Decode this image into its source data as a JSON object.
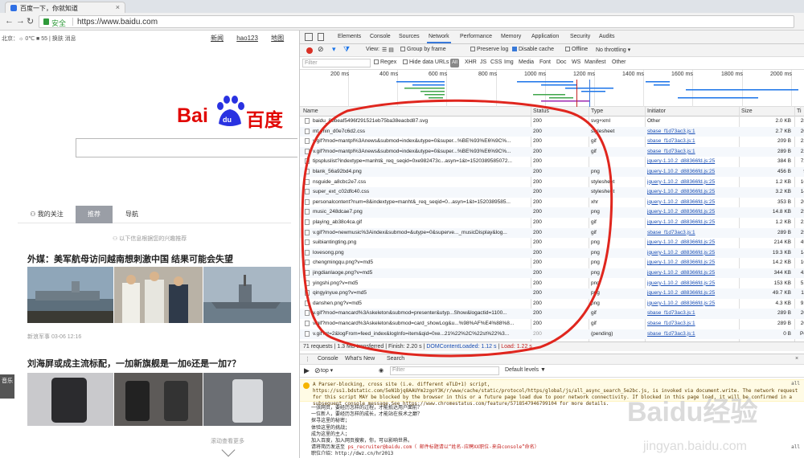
{
  "browser": {
    "tab_title": "百度一下，你就知道",
    "secure_label": "安全",
    "url": "https://www.baidu.com"
  },
  "baidu": {
    "weather": "北京：☼ 0℃  ■ 55 | 换肤  消息",
    "top_links": [
      "新闻",
      "hao123",
      "地图"
    ],
    "logo_left": "Bai",
    "logo_paw": "du",
    "logo_right": "百度",
    "feed_tabs": [
      "我的关注",
      "推荐",
      "导航"
    ],
    "hint": "以下信息根据您的兴趣推荐",
    "news1_title": "外媒：美军航母访问越南想刺激中国 结果可能会失望",
    "news1_meta": "新浪军事   03-06 12:16",
    "news2_title": "刘海屏或成主流标配，一加新旗舰是一加6还是一加7？",
    "side_badge": "音乐",
    "more": "滚动查看更多"
  },
  "devtools": {
    "tabs": [
      "Elements",
      "Console",
      "Sources",
      "Network",
      "Performance",
      "Memory",
      "Application",
      "Security",
      "Audits"
    ],
    "active_tab": "Network",
    "toolbar": {
      "view": "View:",
      "group": "Group by frame",
      "preserve": "Preserve log",
      "disable_cache": "Disable cache",
      "offline": "Offline",
      "throttling": "No throttling"
    },
    "filter_placeholder": "Filter",
    "filter_opts": [
      "Regex",
      "Hide data URLs",
      "All",
      "XHR",
      "JS",
      "CSS",
      "Img",
      "Media",
      "Font",
      "Doc",
      "WS",
      "Manifest",
      "Other"
    ],
    "timeline_ticks": [
      "200 ms",
      "400 ms",
      "600 ms",
      "800 ms",
      "1000 ms",
      "1200 ms",
      "1400 ms",
      "1600 ms",
      "1800 ms",
      "2000 ms"
    ],
    "columns": [
      "Name",
      "Status",
      "Type",
      "Initiator",
      "Size",
      "Ti"
    ],
    "rows": [
      {
        "name": "baidu_85beaf5496f291521eb75ba38eacbd87.svg",
        "status": "200",
        "type": "svg+xml",
        "initiator": "Other",
        "size": "2.0 KB",
        "time": "28"
      },
      {
        "name": "mt_min_d0e7c6d2.css",
        "status": "200",
        "type": "stylesheet",
        "initiator": "sbase_f1d73ac3.js:1",
        "size": "2.7 KB",
        "time": "20"
      },
      {
        "name": "v.gif?mod=mantpl%3Anews&submod=index&utype=0&super...%BE%93%E6%9C%...",
        "status": "200",
        "type": "gif",
        "initiator": "sbase_f1d73ac3.js:1",
        "size": "209 B",
        "time": "22"
      },
      {
        "name": "v.gif?mod=mantpl%3Anews&submod=index&utype=0&super...%BE%93%E6%9C%...",
        "status": "200",
        "type": "gif",
        "initiator": "sbase_f1d73ac3.js:1",
        "size": "289 B",
        "time": "22"
      },
      {
        "name": "tipspluslist?indextype=manht&_req_seqid=0xe982473c...asyn=1&t=1520389585072...",
        "status": "200",
        "type": "",
        "initiator": "jquery-1.10.2_d88366fd.js:25",
        "size": "384 B",
        "time": "72"
      },
      {
        "name": "blank_56a92bd4.png",
        "status": "200",
        "type": "png",
        "initiator": "jquery-1.10.2_d88366fd.js:25",
        "size": "456 B",
        "time": "9"
      },
      {
        "name": "nsguide_a8cbc2e7.css",
        "status": "200",
        "type": "stylesheet",
        "initiator": "jquery-1.10.2_d88366fd.js:25",
        "size": "1.2 KB",
        "time": "16"
      },
      {
        "name": "super_ext_c02dfc40.css",
        "status": "200",
        "type": "stylesheet",
        "initiator": "jquery-1.10.2_d88366fd.js:25",
        "size": "3.2 KB",
        "time": "14"
      },
      {
        "name": "personalcontent?num=8&indextype=manht&_req_seqid=0...asyn=1&t=1520389585...",
        "status": "200",
        "type": "xhr",
        "initiator": "jquery-1.10.2_d88366fd.js:25",
        "size": "353 B",
        "time": "20"
      },
      {
        "name": "music_248dcae7.png",
        "status": "200",
        "type": "png",
        "initiator": "jquery-1.10.2_d88366fd.js:25",
        "size": "14.8 KB",
        "time": "25"
      },
      {
        "name": "playing_ab38c4ca.gif",
        "status": "200",
        "type": "gif",
        "initiator": "jquery-1.10.2_d88366fd.js:25",
        "size": "1.2 KB",
        "time": "22"
      },
      {
        "name": "v.gif?mod=newmusic%3Aindex&submod=&utype=0&superve..._musicDisplay&log...",
        "status": "200",
        "type": "gif",
        "initiator": "sbase_f1d73ac3.js:1",
        "size": "289 B",
        "time": "25"
      },
      {
        "name": "suibiantingting.png",
        "status": "200",
        "type": "png",
        "initiator": "jquery-1.10.2_d88366fd.js:25",
        "size": "214 KB",
        "time": "45"
      },
      {
        "name": "lovesong.png",
        "status": "200",
        "type": "png",
        "initiator": "jquery-1.10.2_d88366fd.js:25",
        "size": "19.3 KB",
        "time": "14"
      },
      {
        "name": "chengmingqu.png?v=md5",
        "status": "200",
        "type": "png",
        "initiator": "jquery-1.10.2_d88366fd.js:25",
        "size": "14.2 KB",
        "time": "10"
      },
      {
        "name": "jingdianlaoge.png?v=md5",
        "status": "200",
        "type": "png",
        "initiator": "jquery-1.10.2_d88366fd.js:25",
        "size": "344 KB",
        "time": "42"
      },
      {
        "name": "yingshi.png?v=md5",
        "status": "200",
        "type": "png",
        "initiator": "jquery-1.10.2_d88366fd.js:25",
        "size": "153 KB",
        "time": "51"
      },
      {
        "name": "qingyinyue.png?v=md5",
        "status": "200",
        "type": "png",
        "initiator": "jquery-1.10.2_d88366fd.js:25",
        "size": "49.7 KB",
        "time": "11"
      },
      {
        "name": "danshen.png?v=md5",
        "status": "200",
        "type": "png",
        "initiator": "jquery-1.10.2_d88366fd.js:25",
        "size": "4.3 KB",
        "time": "91"
      },
      {
        "name": "v.gif?mod=mancard%3Askeleton&submod=presenter&utyp...Show&logactid=1100...",
        "status": "200",
        "type": "gif",
        "initiator": "sbase_f1d73ac3.js:1",
        "size": "289 B",
        "time": "20"
      },
      {
        "name": "v.gif?mod=mancard%3Askeleton&submod=card_showLog&u...%98%AF%E4%88%8...",
        "status": "200",
        "type": "gif",
        "initiator": "sbase_f1d73ac3.js:1",
        "size": "289 B",
        "time": "20"
      },
      {
        "name": "v.gif?ct=2&logFrom=feed_index&logInfo=item&qid=0xe...21%22%2C%22st%22%3...",
        "status": "200",
        "type": "(pending)",
        "initiator": "sbase_f1d73ac3.js:1",
        "size": "0 B",
        "time": "Pe"
      }
    ],
    "summary": {
      "requests": "71 requests",
      "transferred": "1.3 MB transferred",
      "finish": "Finish: 2.20 s",
      "dcl": "DOMContentLoaded: 1.12 s",
      "load": "Load: 1.22 s"
    },
    "drawer_tabs": [
      "Console",
      "What's New",
      "Search"
    ],
    "console_context": "top",
    "console_filter": "Filter",
    "console_levels": "Default levels ▼",
    "warning": "A Parser-blocking, cross site (i.e. different eTLD+1) script, https://ss1.bdstatic.com/5eN1bjq8AAUYm2zgoY3K/r/www/cache/static/protocol/https/global/js/all_async_search_5e2bc.js, is invoked via document.write. The network request for this script MAY be blocked by the browser in this or a future page load due to poor network connectivity. If blocked in this page load, it will be confirmed in a subsequent console message.See https://www.chromestatus.com/feature/5718547946799104 for more details.",
    "warning_src": "all",
    "console_lines": [
      "一张网页，要经历怎样的过程，才能抵达用户面前？",
      "一位新人，要经历怎样的成长，才能站在技术之巅？",
      "探寻这里的秘密；",
      "体验这里的挑战；",
      "成为这里的主人；",
      "加入百度，加入网页搜索，你，可以影响世界。"
    ],
    "recruit_label": "请将简历发送至",
    "recruit_email": "ps_recruiter@baidu.com（ 邮件标题请以“姓名-应聘XX职位-来自console”命名）",
    "recruit_src": "all",
    "last_line": "职位介绍：http://dwz.cn/hr2013"
  },
  "watermark": {
    "text": "Baidu经验",
    "sub": "jingyan.baidu.com"
  }
}
